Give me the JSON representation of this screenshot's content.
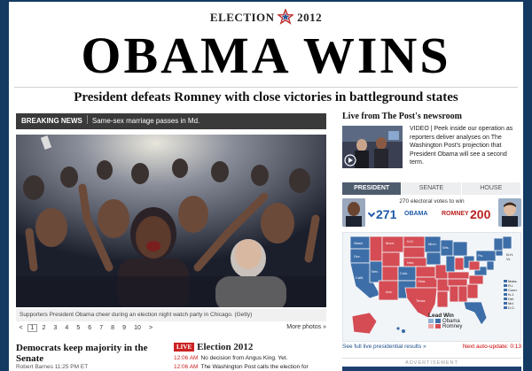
{
  "header": {
    "kicker_left": "ELECTION",
    "kicker_right": "2012",
    "headline": "OBAMA WINS",
    "deck": "President defeats Romney with close victories in battleground states"
  },
  "breaking": {
    "label": "BREAKING NEWS",
    "text": "Same-sex marriage passes in Md."
  },
  "photo": {
    "caption": "Supporters President Obama cheer during an election night watch party in Chicago. (Getty)"
  },
  "pager": {
    "prev": "<",
    "pages": [
      "1",
      "2",
      "3",
      "4",
      "5",
      "6",
      "7",
      "8",
      "9",
      "10"
    ],
    "active_page": "1",
    "next": ">",
    "more": "More photos »"
  },
  "story": {
    "headline": "Democrats keep majority in the Senate",
    "byline": "Robert Barnes 11:25 PM ET"
  },
  "election_feed": {
    "badge": "LIVE",
    "title": "Election 2012",
    "items": [
      {
        "time": "12:06 AM",
        "text": "No decision from Angus King. Yet."
      },
      {
        "time": "12:06 AM",
        "text": "The Washington Post calls the election for"
      }
    ]
  },
  "newsroom": {
    "title": "Live from The Post's newsroom",
    "text": "VIDEO | Peek inside our operation as reporters deliver analyses on The Washington Post's projection that President Obama will see a second term."
  },
  "results": {
    "tabs": [
      "PRESIDENT",
      "SENATE",
      "HOUSE"
    ],
    "active_tab": "PRESIDENT",
    "ev_note": "270 electoral votes to win",
    "obama_votes": "271",
    "obama_label": "OBAMA",
    "romney_label": "ROMNEY",
    "romney_votes": "200",
    "legend_title": "Lead Win",
    "legend_obama": "Obama",
    "legend_romney": "Romney",
    "map_labels": {
      "nh_vt": "N.H.\nVt.",
      "ne_list": [
        "Mass.",
        "R.I.",
        "Conn.",
        "N.J.",
        "Del.",
        "Md.",
        "D.C."
      ]
    },
    "footer_link": "See full live presidential results »",
    "next_update": "Next auto-update: 0:13",
    "ad_label": "ADVERTISEMENT",
    "colors": {
      "dem": "#3d6ea8",
      "dem_lead": "#8fb0d6",
      "rep": "#d54c54",
      "rep_lead": "#eba4a8"
    }
  }
}
